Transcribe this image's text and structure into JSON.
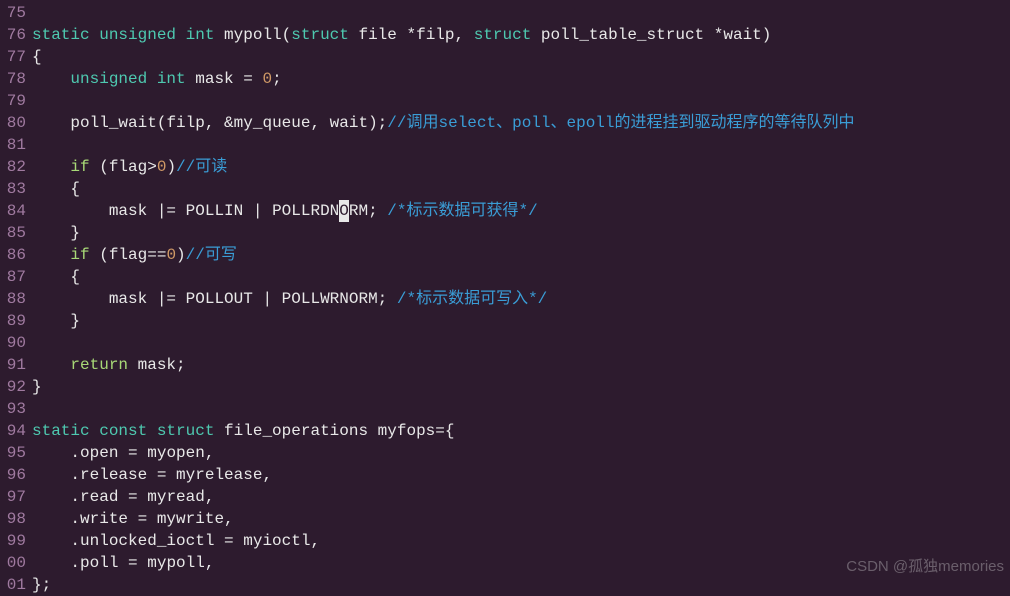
{
  "watermark": "CSDN @孤独memories",
  "cursor_line": 84,
  "lines": [
    {
      "num": "75",
      "tokens": []
    },
    {
      "num": "76",
      "tokens": [
        {
          "t": "static ",
          "c": "kw-type"
        },
        {
          "t": "unsigned ",
          "c": "kw-type"
        },
        {
          "t": "int ",
          "c": "kw-type"
        },
        {
          "t": "mypoll",
          "c": "fn-name"
        },
        {
          "t": "(",
          "c": "punct"
        },
        {
          "t": "struct",
          "c": "kw-struct"
        },
        {
          "t": " file ",
          "c": "ident"
        },
        {
          "t": "*",
          "c": "punct"
        },
        {
          "t": "filp",
          "c": "ident"
        },
        {
          "t": ", ",
          "c": "punct"
        },
        {
          "t": "struct",
          "c": "kw-struct"
        },
        {
          "t": " poll_table_struct ",
          "c": "ident"
        },
        {
          "t": "*",
          "c": "punct"
        },
        {
          "t": "wait",
          "c": "ident"
        },
        {
          "t": ")",
          "c": "punct"
        }
      ]
    },
    {
      "num": "77",
      "tokens": [
        {
          "t": "{",
          "c": "punct"
        }
      ]
    },
    {
      "num": "78",
      "tokens": [
        {
          "t": "    ",
          "c": ""
        },
        {
          "t": "unsigned ",
          "c": "kw-type"
        },
        {
          "t": "int ",
          "c": "kw-type"
        },
        {
          "t": "mask ",
          "c": "ident"
        },
        {
          "t": "= ",
          "c": "punct"
        },
        {
          "t": "0",
          "c": "num"
        },
        {
          "t": ";",
          "c": "punct"
        }
      ]
    },
    {
      "num": "79",
      "tokens": []
    },
    {
      "num": "80",
      "tokens": [
        {
          "t": "    ",
          "c": ""
        },
        {
          "t": "poll_wait",
          "c": "fn-name"
        },
        {
          "t": "(",
          "c": "punct"
        },
        {
          "t": "filp",
          "c": "ident"
        },
        {
          "t": ", &",
          "c": "punct"
        },
        {
          "t": "my_queue",
          "c": "ident"
        },
        {
          "t": ", ",
          "c": "punct"
        },
        {
          "t": "wait",
          "c": "ident"
        },
        {
          "t": ");",
          "c": "punct"
        },
        {
          "t": "//调用select、poll、epoll的进程挂到驱动程序的等待队列中",
          "c": "comment"
        }
      ]
    },
    {
      "num": "81",
      "tokens": []
    },
    {
      "num": "82",
      "tokens": [
        {
          "t": "    ",
          "c": ""
        },
        {
          "t": "if ",
          "c": "kw-ctrl"
        },
        {
          "t": "(",
          "c": "punct"
        },
        {
          "t": "flag",
          "c": "ident"
        },
        {
          "t": ">",
          "c": "punct"
        },
        {
          "t": "0",
          "c": "num"
        },
        {
          "t": ")",
          "c": "punct"
        },
        {
          "t": "//可读",
          "c": "comment"
        }
      ]
    },
    {
      "num": "83",
      "tokens": [
        {
          "t": "    {",
          "c": "punct"
        }
      ]
    },
    {
      "num": "84",
      "tokens": [
        {
          "t": "        ",
          "c": ""
        },
        {
          "t": "mask ",
          "c": "ident"
        },
        {
          "t": "|= ",
          "c": "punct"
        },
        {
          "t": "POLLIN ",
          "c": "ident"
        },
        {
          "t": "| ",
          "c": "punct"
        },
        {
          "t": "POLLRDN",
          "c": "ident"
        },
        {
          "t": "O",
          "c": "ident",
          "cursor": true
        },
        {
          "t": "RM",
          "c": "ident"
        },
        {
          "t": "; ",
          "c": "punct"
        },
        {
          "t": "/*标示数据可获得*/",
          "c": "comment"
        }
      ]
    },
    {
      "num": "85",
      "tokens": [
        {
          "t": "    }",
          "c": "punct"
        }
      ]
    },
    {
      "num": "86",
      "tokens": [
        {
          "t": "    ",
          "c": ""
        },
        {
          "t": "if ",
          "c": "kw-ctrl"
        },
        {
          "t": "(",
          "c": "punct"
        },
        {
          "t": "flag",
          "c": "ident"
        },
        {
          "t": "==",
          "c": "punct"
        },
        {
          "t": "0",
          "c": "num"
        },
        {
          "t": ")",
          "c": "punct"
        },
        {
          "t": "//可写",
          "c": "comment"
        }
      ]
    },
    {
      "num": "87",
      "tokens": [
        {
          "t": "    {",
          "c": "punct"
        }
      ]
    },
    {
      "num": "88",
      "tokens": [
        {
          "t": "        ",
          "c": ""
        },
        {
          "t": "mask ",
          "c": "ident"
        },
        {
          "t": "|= ",
          "c": "punct"
        },
        {
          "t": "POLLOUT ",
          "c": "ident"
        },
        {
          "t": "| ",
          "c": "punct"
        },
        {
          "t": "POLLWRNORM",
          "c": "ident"
        },
        {
          "t": "; ",
          "c": "punct"
        },
        {
          "t": "/*标示数据可写入*/",
          "c": "comment"
        }
      ]
    },
    {
      "num": "89",
      "tokens": [
        {
          "t": "    }",
          "c": "punct"
        }
      ]
    },
    {
      "num": "90",
      "tokens": []
    },
    {
      "num": "91",
      "tokens": [
        {
          "t": "    ",
          "c": ""
        },
        {
          "t": "return ",
          "c": "kw-ctrl"
        },
        {
          "t": "mask",
          "c": "ident"
        },
        {
          "t": ";",
          "c": "punct"
        }
      ]
    },
    {
      "num": "92",
      "tokens": [
        {
          "t": "}",
          "c": "punct"
        }
      ]
    },
    {
      "num": "93",
      "tokens": []
    },
    {
      "num": "94",
      "tokens": [
        {
          "t": "static ",
          "c": "kw-type"
        },
        {
          "t": "const ",
          "c": "kw-type"
        },
        {
          "t": "struct ",
          "c": "kw-struct"
        },
        {
          "t": "file_operations ",
          "c": "ident"
        },
        {
          "t": "myfops",
          "c": "ident"
        },
        {
          "t": "={",
          "c": "punct"
        }
      ]
    },
    {
      "num": "95",
      "tokens": [
        {
          "t": "    .",
          "c": "punct"
        },
        {
          "t": "open ",
          "c": "member"
        },
        {
          "t": "= ",
          "c": "punct"
        },
        {
          "t": "myopen",
          "c": "ident"
        },
        {
          "t": ",",
          "c": "punct"
        }
      ]
    },
    {
      "num": "96",
      "tokens": [
        {
          "t": "    .",
          "c": "punct"
        },
        {
          "t": "release ",
          "c": "member"
        },
        {
          "t": "= ",
          "c": "punct"
        },
        {
          "t": "myrelease",
          "c": "ident"
        },
        {
          "t": ",",
          "c": "punct"
        }
      ]
    },
    {
      "num": "97",
      "tokens": [
        {
          "t": "    .",
          "c": "punct"
        },
        {
          "t": "read ",
          "c": "member"
        },
        {
          "t": "= ",
          "c": "punct"
        },
        {
          "t": "myread",
          "c": "ident"
        },
        {
          "t": ",",
          "c": "punct"
        }
      ]
    },
    {
      "num": "98",
      "tokens": [
        {
          "t": "    .",
          "c": "punct"
        },
        {
          "t": "write ",
          "c": "member"
        },
        {
          "t": "= ",
          "c": "punct"
        },
        {
          "t": "mywrite",
          "c": "ident"
        },
        {
          "t": ",",
          "c": "punct"
        }
      ]
    },
    {
      "num": "99",
      "tokens": [
        {
          "t": "    .",
          "c": "punct"
        },
        {
          "t": "unlocked_ioctl ",
          "c": "member"
        },
        {
          "t": "= ",
          "c": "punct"
        },
        {
          "t": "myioctl",
          "c": "ident"
        },
        {
          "t": ",",
          "c": "punct"
        }
      ]
    },
    {
      "num": "00",
      "tokens": [
        {
          "t": "    .",
          "c": "punct"
        },
        {
          "t": "poll ",
          "c": "member"
        },
        {
          "t": "= ",
          "c": "punct"
        },
        {
          "t": "mypoll",
          "c": "ident"
        },
        {
          "t": ",",
          "c": "punct"
        }
      ]
    },
    {
      "num": "01",
      "tokens": [
        {
          "t": "};",
          "c": "punct"
        }
      ]
    }
  ]
}
